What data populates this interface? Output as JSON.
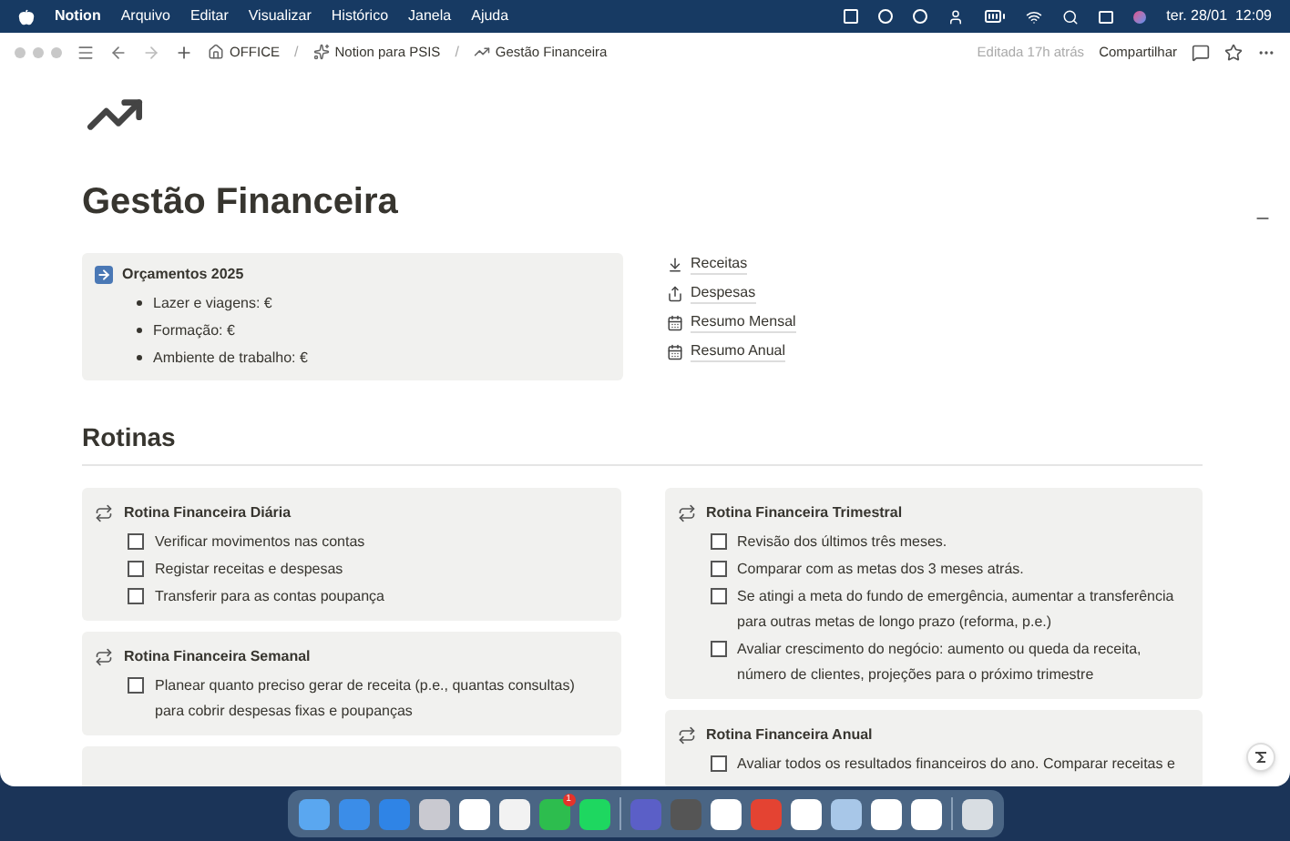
{
  "menubar": {
    "app": "Notion",
    "menus": [
      "Arquivo",
      "Editar",
      "Visualizar",
      "Histórico",
      "Janela",
      "Ajuda"
    ],
    "clock": "ter. 28/01  12:09"
  },
  "toolbar": {
    "breadcrumbs": [
      {
        "kind": "home",
        "label": "OFFICE"
      },
      {
        "kind": "sparkle",
        "label": "Notion para PSIS"
      },
      {
        "kind": "chart",
        "label": "Gestão Financeira"
      }
    ],
    "separator": "/",
    "edited": "Editada 17h atrás",
    "share": "Compartilhar"
  },
  "page": {
    "title": "Gestão Financeira",
    "callout": {
      "title": "Orçamentos 2025",
      "items": [
        "Lazer e viagens: €",
        "Formação: €",
        "Ambiente de trabalho: €"
      ]
    },
    "links": [
      {
        "kind": "download",
        "label": "Receitas"
      },
      {
        "kind": "upload",
        "label": "Despesas"
      },
      {
        "kind": "calendar",
        "label": "Resumo Mensal"
      },
      {
        "kind": "calendar",
        "label": "Resumo Anual"
      }
    ],
    "section": "Rotinas",
    "columns": [
      [
        {
          "title": "Rotina Financeira Diária",
          "tasks": [
            {
              "text": "Verificar movimentos nas contas",
              "checked": false
            },
            {
              "text": "Registar receitas e despesas",
              "checked": false
            },
            {
              "text": "Transferir para as contas poupança",
              "checked": false
            }
          ]
        },
        {
          "title": "Rotina Financeira Semanal",
          "tasks": [
            {
              "text": "Planear quanto preciso gerar de receita (p.e., quantas consultas) para cobrir despesas fixas e poupanças",
              "checked": false
            }
          ]
        }
      ],
      [
        {
          "title": "Rotina Financeira Trimestral",
          "tasks": [
            {
              "text": "Revisão dos últimos três meses.",
              "checked": false
            },
            {
              "text": "Comparar com as metas dos 3 meses atrás.",
              "checked": false
            },
            {
              "text": "Se atingi a meta do fundo de emergência, aumentar a transferência para outras metas de longo prazo (reforma, p.e.)",
              "checked": false
            },
            {
              "text": "Avaliar crescimento do negócio: aumento ou queda da receita, número de clientes, projeções para o próximo trimestre",
              "checked": false
            }
          ]
        },
        {
          "title": "Rotina Financeira Anual",
          "tasks": [
            {
              "text": "Avaliar todos os resultados financeiros do ano. Comparar receitas e",
              "checked": false
            }
          ]
        }
      ]
    ]
  },
  "dock": {
    "badge": "1"
  }
}
